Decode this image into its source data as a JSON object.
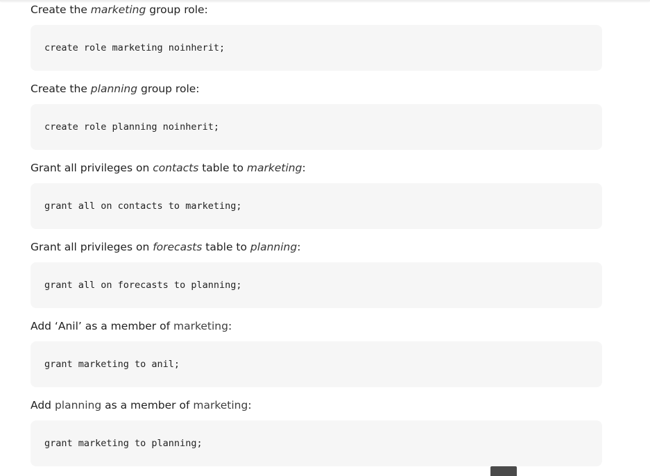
{
  "blocks": [
    {
      "para": [
        {
          "t": "Create the ",
          "s": "n"
        },
        {
          "t": "marketing",
          "s": "i"
        },
        {
          "t": " group role:",
          "s": "n"
        }
      ],
      "code": "create role marketing noinherit;"
    },
    {
      "para": [
        {
          "t": "Create the ",
          "s": "n"
        },
        {
          "t": "planning",
          "s": "i"
        },
        {
          "t": " group role:",
          "s": "n"
        }
      ],
      "code": "create role planning noinherit;"
    },
    {
      "para": [
        {
          "t": "Grant all privileges on ",
          "s": "n"
        },
        {
          "t": "contacts",
          "s": "i"
        },
        {
          "t": " table to ",
          "s": "n"
        },
        {
          "t": "marketing",
          "s": "i"
        },
        {
          "t": ":",
          "s": "n"
        }
      ],
      "code": "grant all on contacts to marketing;"
    },
    {
      "para": [
        {
          "t": "Grant all privileges on ",
          "s": "n"
        },
        {
          "t": "forecasts",
          "s": "i"
        },
        {
          "t": " table to ",
          "s": "n"
        },
        {
          "t": "planning",
          "s": "i"
        },
        {
          "t": ":",
          "s": "n"
        }
      ],
      "code": "grant all on forecasts to planning;"
    },
    {
      "para": [
        {
          "t": "Add ‘Anil’ as a member of ",
          "s": "n"
        },
        {
          "t": "marketing",
          "s": "m"
        },
        {
          "t": ":",
          "s": "n"
        }
      ],
      "code": "grant marketing to anil;"
    },
    {
      "para": [
        {
          "t": "Add ",
          "s": "n"
        },
        {
          "t": "planning",
          "s": "m"
        },
        {
          "t": " as a member of ",
          "s": "n"
        },
        {
          "t": "marketing",
          "s": "m"
        },
        {
          "t": ":",
          "s": "n"
        }
      ],
      "code": "grant marketing to planning;"
    }
  ],
  "colors": {
    "code_background": "#f6f6f6",
    "text": "#1f1f1f",
    "scroll_button": "#4a4a4a"
  },
  "icons": {
    "scroll_top": "scroll-to-top-icon"
  }
}
